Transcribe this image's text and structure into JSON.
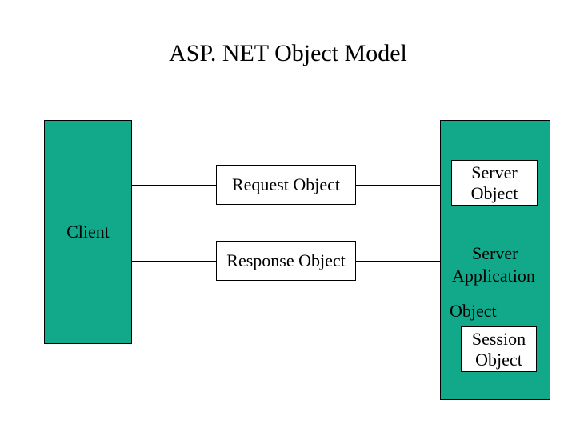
{
  "title": "ASP. NET Object Model",
  "client_label": "Client",
  "request_label": "Request Object",
  "response_label": "Response Object",
  "server_object_label": "Server\nObject",
  "server_label": "Server",
  "application_label": "Application",
  "object_word": "Object",
  "session_label": "Session\nObject"
}
